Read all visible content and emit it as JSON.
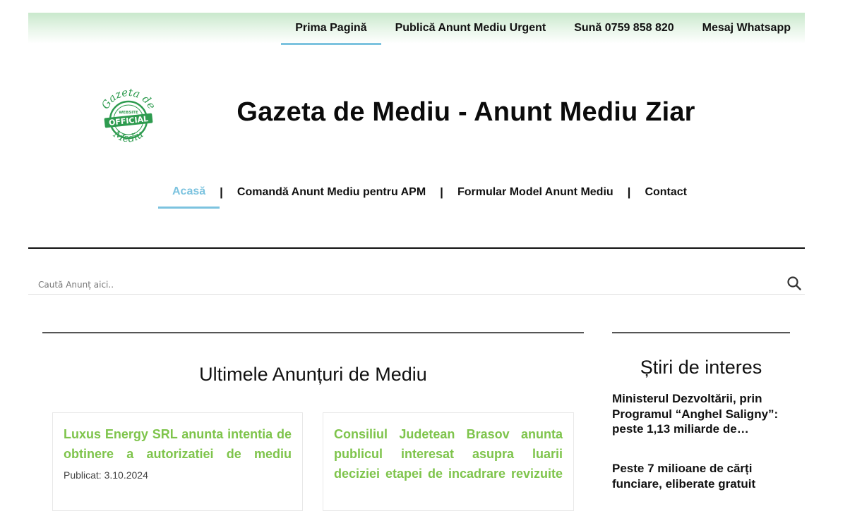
{
  "topnav": {
    "items": [
      {
        "label": "Prima Pagină"
      },
      {
        "label": "Publică Anunt Mediu Urgent"
      },
      {
        "label": "Sună 0759 858 820"
      },
      {
        "label": "Mesaj Whatsapp"
      }
    ]
  },
  "logo": {
    "top_text": "Gazeta de",
    "badge_small": "WEBSITE",
    "badge_main": "OFFICIAL",
    "bottom_text": "Mediu",
    "color": "#2e9b4f"
  },
  "header": {
    "title": "Gazeta de Mediu - Anunt Mediu Ziar"
  },
  "mainnav": {
    "items": [
      {
        "label": "Acasă"
      },
      {
        "label": "Comandă Anunt Mediu pentru APM"
      },
      {
        "label": "Formular Model Anunt Mediu"
      },
      {
        "label": "Contact"
      }
    ],
    "separator": "|"
  },
  "search": {
    "placeholder": "Caută Anunț aici..",
    "icon": "search-icon"
  },
  "main": {
    "section_title": "Ultimele Anunțuri de Mediu",
    "cards": [
      {
        "title": "Luxus Energy SRL anunta intentia de obtinere a autorizatiei de mediu",
        "meta": "Publicat: 3.10.2024"
      },
      {
        "title": "Consiliul Judetean Brasov anunta publicul interesat asupra luarii deciziei etapei de incadrare revizuite",
        "meta": ""
      }
    ]
  },
  "sidebar": {
    "title": "Știri de interes",
    "items": [
      {
        "title": "Ministerul Dezvoltării, prin Programul “Anghel Saligny”: peste 1,13 miliarde de…"
      },
      {
        "title": "Peste 7 milioane de cărți funciare, eliberate gratuit"
      }
    ]
  },
  "colors": {
    "accent": "#7cc3df",
    "card_title": "#7ec44b",
    "topbar_green": "#c9e8cc"
  }
}
